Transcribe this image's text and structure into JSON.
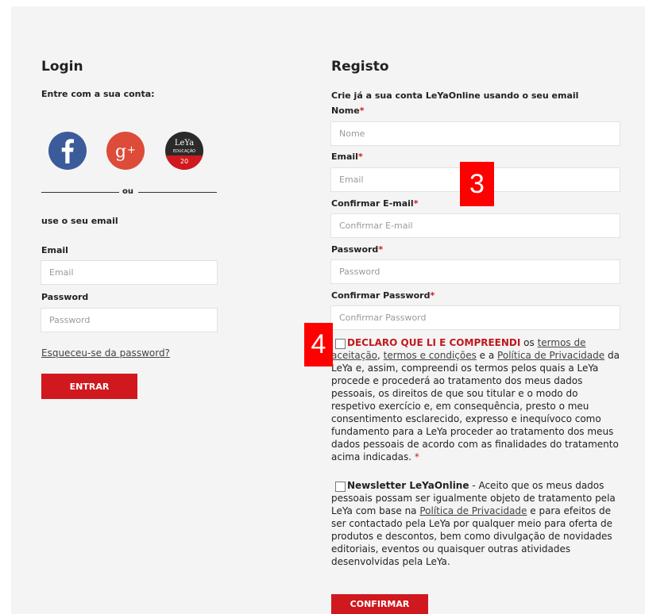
{
  "login": {
    "title": "Login",
    "subtitle": "Entre com a sua conta:",
    "or_text": "ou",
    "use_email": "use o seu email",
    "email_label": "Email",
    "email_placeholder": "Email",
    "password_label": "Password",
    "password_placeholder": "Password",
    "forgot_link": "Esqueceu-se da password?",
    "submit_label": "ENTRAR",
    "social": {
      "leya_line1": "LeYa",
      "leya_line2": "EDUCAÇÃO",
      "leya_line3": "20"
    }
  },
  "register": {
    "title": "Registo",
    "subtitle": "Crie já a sua conta LeYaOnline usando o seu email",
    "required_mark": "*",
    "fields": {
      "name_label": "Nome",
      "name_placeholder": "Nome",
      "email_label": "Email",
      "email_placeholder": "Email",
      "confirm_email_label": "Confirmar E-mail",
      "confirm_email_placeholder": "Confirmar E-mail",
      "password_label": "Password",
      "password_placeholder": "Password",
      "confirm_password_label": "Confirmar Password",
      "confirm_password_placeholder": "Confirmar Password"
    },
    "terms": {
      "strong": "DECLARO QUE LI E COMPREENDI",
      "t1": " os ",
      "link1": "termos de aceitação",
      "t2": ", ",
      "link2": "termos e condições",
      "t3": " e a ",
      "link3": "Política de Privacidade",
      "t4": " da LeYa e, assim, compreendi os termos pelos quais a LeYa procede e procederá ao tratamento dos meus dados pessoais, os direitos de que sou titular e o modo do respetivo exercício e, em consequência, presto o meu consentimento esclarecido, expresso e inequívoco como fundamento para a LeYa proceder ao tratamento dos meus dados pessoais de acordo com as finalidades do tratamento acima indicadas.",
      "req": " *"
    },
    "newsletter": {
      "strong": "Newsletter LeYaOnline",
      "t1": " - Aceito que os meus dados pessoais possam ser igualmente objeto de tratamento pela LeYa com base na ",
      "link": "Política de Privacidade",
      "t2": " e para efeitos de ser contactado pela LeYa por qualquer meio para oferta de produtos e descontos, bem como divulgação de novidades editoriais, eventos ou quaisquer outras atividades desenvolvidas pela LeYa."
    },
    "submit_label": "CONFIRMAR"
  },
  "markers": {
    "m3": "3",
    "m4": "4"
  }
}
